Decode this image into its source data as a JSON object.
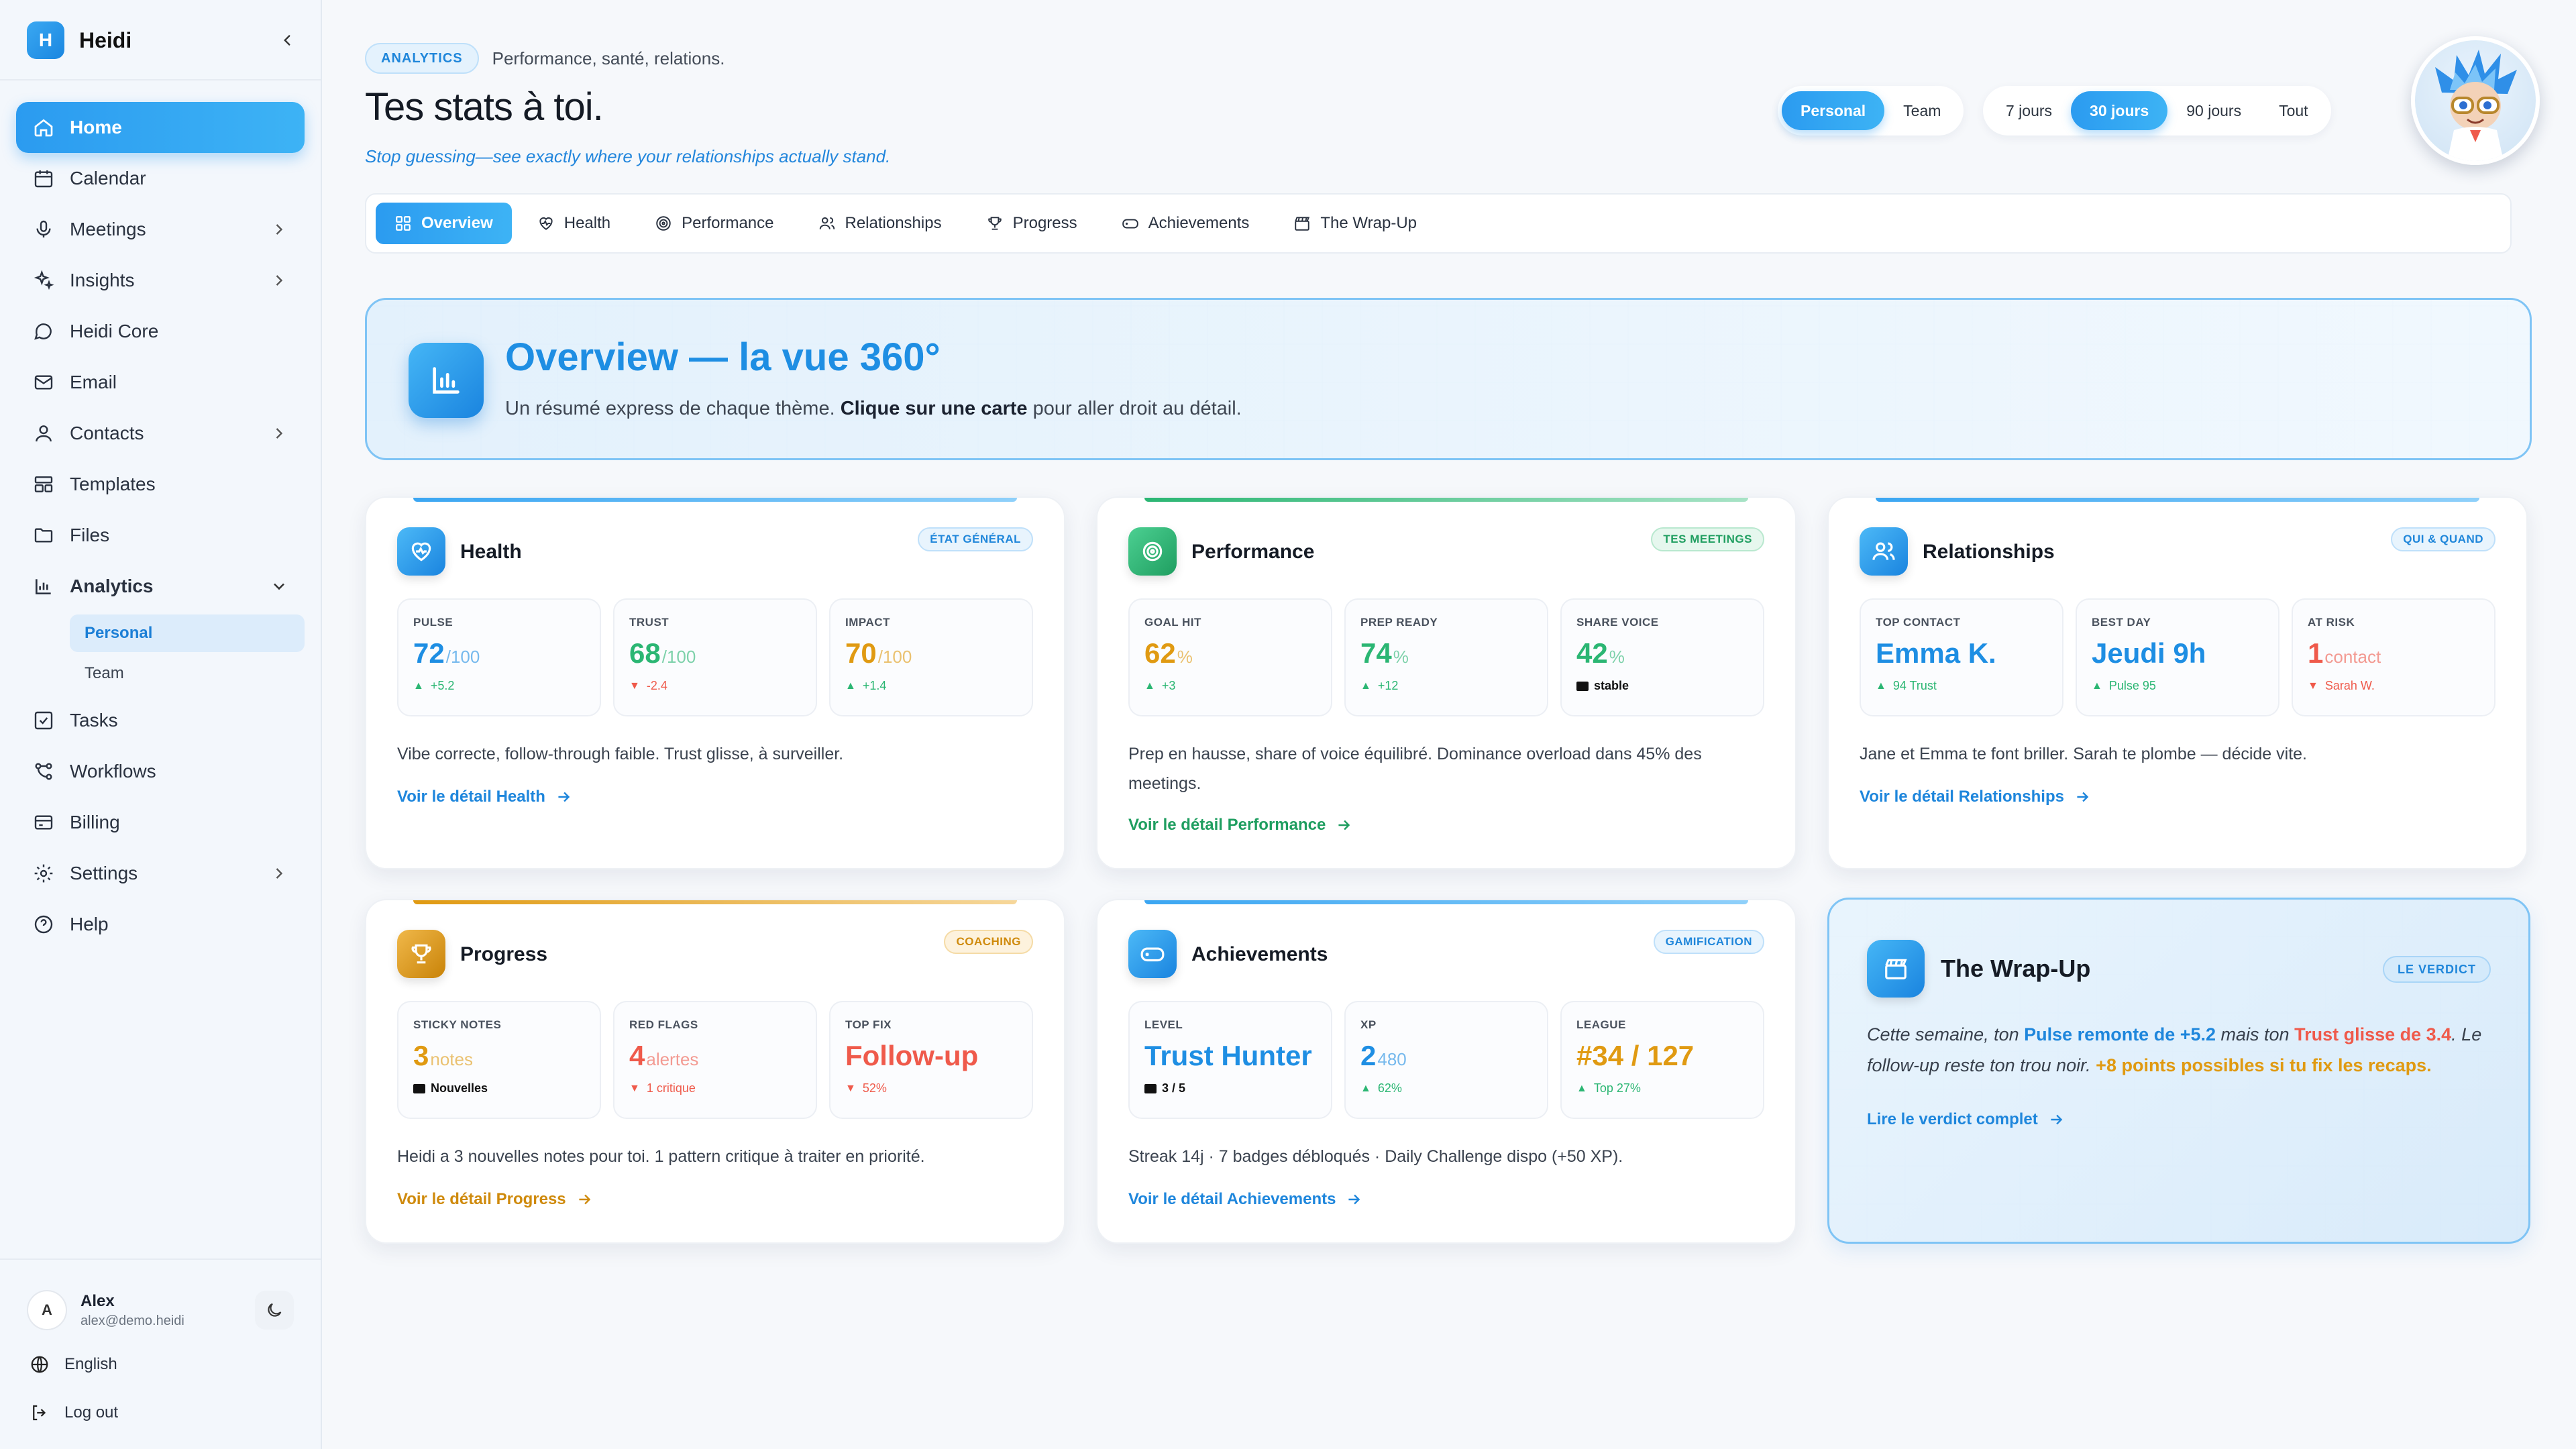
{
  "app": {
    "logo_letter": "H",
    "name": "Heidi"
  },
  "sidebar": {
    "items": [
      {
        "label": "Home"
      },
      {
        "label": "Calendar"
      },
      {
        "label": "Meetings"
      },
      {
        "label": "Insights"
      },
      {
        "label": "Heidi Core"
      },
      {
        "label": "Email"
      },
      {
        "label": "Contacts"
      },
      {
        "label": "Templates"
      },
      {
        "label": "Files"
      },
      {
        "label": "Analytics"
      },
      {
        "label": "Tasks"
      },
      {
        "label": "Workflows"
      },
      {
        "label": "Billing"
      },
      {
        "label": "Settings"
      },
      {
        "label": "Help"
      }
    ],
    "analytics_sub": [
      {
        "label": "Personal"
      },
      {
        "label": "Team"
      }
    ],
    "user": {
      "initial": "A",
      "name": "Alex",
      "email": "alex@demo.heidi"
    },
    "language": "English",
    "logout": "Log out"
  },
  "header": {
    "badge": "ANALYTICS",
    "subtitle": "Performance, santé, relations.",
    "title": "Tes stats à toi.",
    "tagline": "Stop guessing—see exactly where your relationships actually stand.",
    "scope": [
      "Personal",
      "Team"
    ],
    "scope_selected": "Personal",
    "periods": [
      "7 jours",
      "30 jours",
      "90 jours",
      "Tout"
    ],
    "period_selected": "30 jours"
  },
  "tabs": [
    "Overview",
    "Health",
    "Performance",
    "Relationships",
    "Progress",
    "Achievements",
    "The Wrap-Up"
  ],
  "hero": {
    "title": "Overview — la vue 360°",
    "sub_before": "Un résumé express de chaque thème. ",
    "sub_bold": "Clique sur une carte",
    "sub_after": " pour aller droit au détail."
  },
  "cards": {
    "health": {
      "title": "Health",
      "tag": "ÉTAT GÉNÉRAL",
      "metrics": [
        {
          "label": "PULSE",
          "value": "72",
          "unit": "/100",
          "delta": "+5.2"
        },
        {
          "label": "TRUST",
          "value": "68",
          "unit": "/100",
          "delta": "-2.4"
        },
        {
          "label": "IMPACT",
          "value": "70",
          "unit": "/100",
          "delta": "+1.4"
        }
      ],
      "desc": "Vibe correcte, follow-through faible. Trust glisse, à surveiller.",
      "link": "Voir le détail Health"
    },
    "performance": {
      "title": "Performance",
      "tag": "TES MEETINGS",
      "metrics": [
        {
          "label": "GOAL HIT",
          "value": "62",
          "unit": "%",
          "delta": "+3"
        },
        {
          "label": "PREP READY",
          "value": "74",
          "unit": "%",
          "delta": "+12"
        },
        {
          "label": "SHARE VOICE",
          "value": "42",
          "unit": "%",
          "delta": "stable"
        }
      ],
      "desc": "Prep en hausse, share of voice équilibré. Dominance overload dans 45% des meetings.",
      "link": "Voir le détail Performance"
    },
    "relationships": {
      "title": "Relationships",
      "tag": "QUI & QUAND",
      "metrics": [
        {
          "label": "TOP CONTACT",
          "value": "Emma K.",
          "unit": "",
          "delta": "94 Trust"
        },
        {
          "label": "BEST DAY",
          "value": "Jeudi 9h",
          "unit": "",
          "delta": "Pulse 95"
        },
        {
          "label": "AT RISK",
          "value": "1",
          "unit": " contact",
          "delta": "Sarah W."
        }
      ],
      "desc": "Jane et Emma te font briller. Sarah te plombe — décide vite.",
      "link": "Voir le détail Relationships"
    },
    "progress": {
      "title": "Progress",
      "tag": "COACHING",
      "metrics": [
        {
          "label": "STICKY NOTES",
          "value": "3",
          "unit": " notes",
          "delta": "Nouvelles"
        },
        {
          "label": "RED FLAGS",
          "value": "4",
          "unit": " alertes",
          "delta": "1 critique"
        },
        {
          "label": "TOP FIX",
          "value": "Follow-up",
          "unit": "",
          "delta": "52%"
        }
      ],
      "desc": "Heidi a 3 nouvelles notes pour toi. 1 pattern critique à traiter en priorité.",
      "link": "Voir le détail Progress"
    },
    "achievements": {
      "title": "Achievements",
      "tag": "GAMIFICATION",
      "metrics": [
        {
          "label": "LEVEL",
          "value": "Trust Hunter",
          "unit": "",
          "delta": "3 / 5"
        },
        {
          "label": "XP",
          "value": "2",
          "unit": " 480",
          "delta": "62%"
        },
        {
          "label": "LEAGUE",
          "value": "#34 / 127",
          "unit": "",
          "delta": "Top 27%"
        }
      ],
      "desc": "Streak 14j · 7 badges débloqués · Daily Challenge dispo (+50 XP).",
      "link": "Voir le détail Achievements"
    }
  },
  "wrap": {
    "title": "The Wrap-Up",
    "tag": "LE VERDICT",
    "t1": "Cette semaine, ton ",
    "b1": "Pulse remonte de +5.2",
    "t2": " mais ton ",
    "r1": "Trust glisse de 3.4",
    "t3": ". Le follow-up reste ton trou noir. ",
    "o1": "+8 points possibles si tu fix les recaps.",
    "link": "Lire le verdict complet"
  },
  "colors": {
    "accent": "#2b9bf0",
    "green": "#2bb673",
    "orange": "#e09a12",
    "red": "#ef5a4b"
  }
}
